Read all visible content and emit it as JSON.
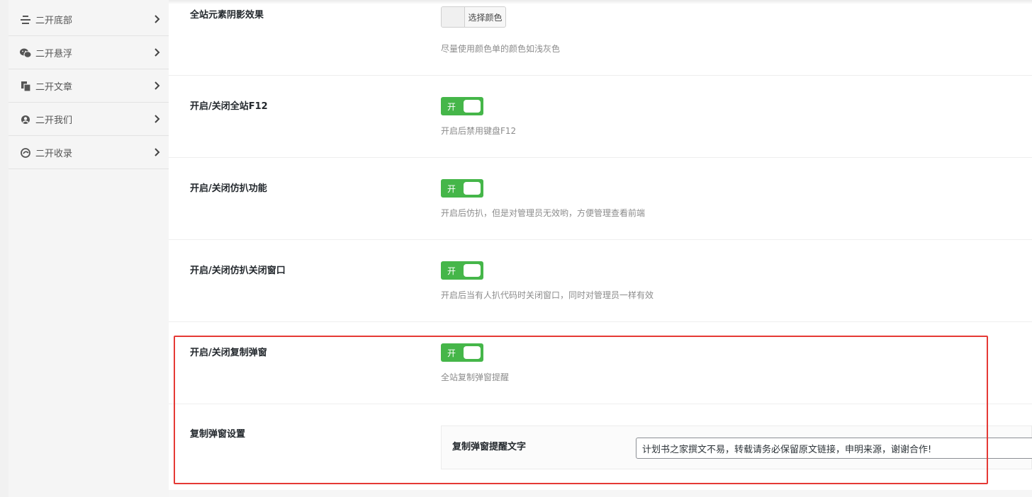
{
  "sidebar": {
    "items": [
      {
        "label": "二开底部",
        "icon": "align-center-icon"
      },
      {
        "label": "二开悬浮",
        "icon": "wechat-icon"
      },
      {
        "label": "二开文章",
        "icon": "copy-pages-icon"
      },
      {
        "label": "二开我们",
        "icon": "user-circle-icon"
      },
      {
        "label": "二开收录",
        "icon": "edge-browser-icon"
      }
    ]
  },
  "settings": {
    "shadow": {
      "title": "全站元素阴影效果",
      "button_label": "选择颜色",
      "desc": "尽量使用颜色单的颜色如浅灰色"
    },
    "f12": {
      "title": "开启/关闭全站F12",
      "toggle_label": "开",
      "desc": "开启后禁用键盘F12"
    },
    "antigrab": {
      "title": "开启/关闭仿扒功能",
      "toggle_label": "开",
      "desc": "开启后仿扒，但是对管理员无效哟，方便管理查看前端"
    },
    "antigrab_close": {
      "title": "开启/关闭仿扒关闭窗口",
      "toggle_label": "开",
      "desc": "开启后当有人扒代码时关闭窗口，同时对管理员一样有效"
    },
    "copy_popup": {
      "title": "开启/关闭复制弹窗",
      "toggle_label": "开",
      "desc": "全站复制弹窗提醒"
    },
    "copy_popup_settings": {
      "title": "复制弹窗设置",
      "field_label": "复制弹窗提醒文字",
      "field_value": "计划书之家撰文不易，转载请务必保留原文链接，申明来源，谢谢合作!"
    }
  },
  "colors": {
    "toggle_on": "#45b649",
    "highlight": "#e53935"
  }
}
